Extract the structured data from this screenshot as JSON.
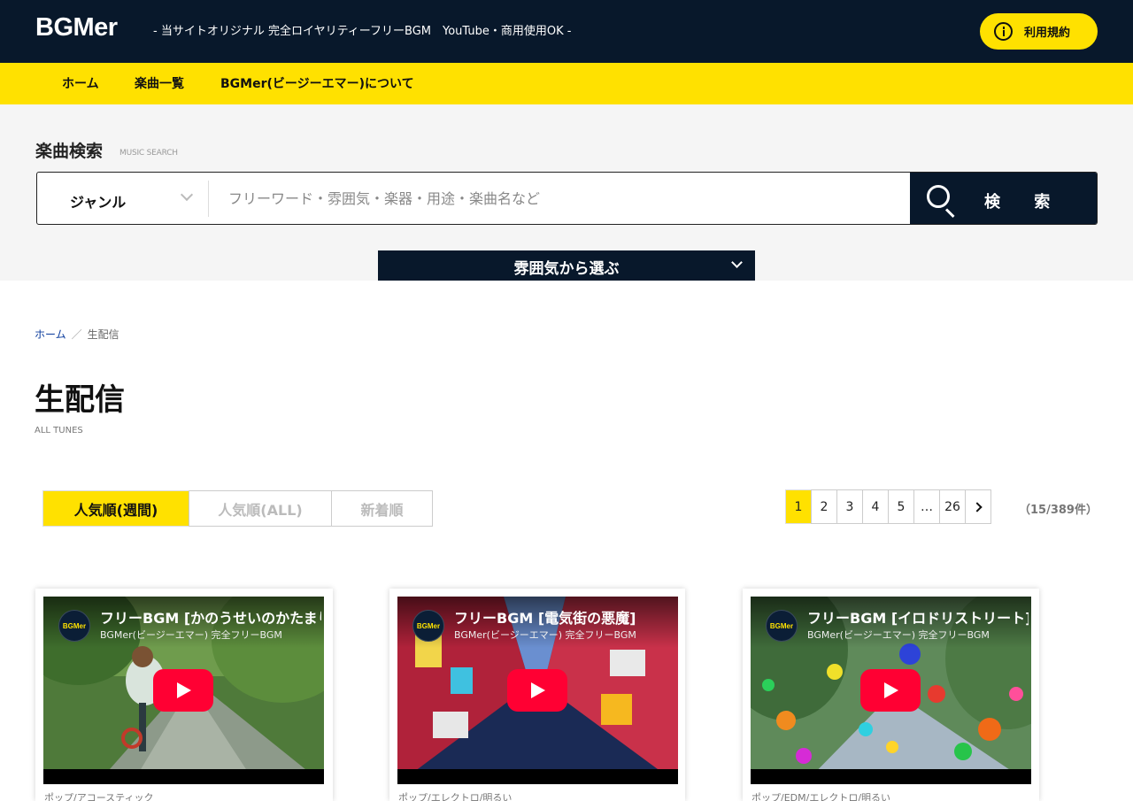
{
  "header": {
    "logo": "BGMer",
    "tagline": "- 当サイトオリジナル 完全ロイヤリティーフリーBGM　YouTube・商用使用OK -",
    "terms_label": "利用規約"
  },
  "nav": {
    "items": [
      "ホーム",
      "楽曲一覧",
      "BGMer(ビージーエマー)について"
    ]
  },
  "search": {
    "title": "楽曲検索",
    "subtitle": "MUSIC SEARCH",
    "genre_label": "ジャンル",
    "placeholder": "フリーワード・雰囲気・楽器・用途・楽曲名など",
    "button_label": "検 索",
    "mood_label": "雰囲気から選ぶ"
  },
  "breadcrumb": {
    "home": "ホーム",
    "separator": "／",
    "current": "生配信"
  },
  "page": {
    "title": "生配信",
    "subtitle": "ALL TUNES"
  },
  "sort_tabs": [
    {
      "label": "人気順(週間)",
      "active": true
    },
    {
      "label": "人気順(ALL)",
      "active": false
    },
    {
      "label": "新着順",
      "active": false
    }
  ],
  "pagination": {
    "pages": [
      "1",
      "2",
      "3",
      "4",
      "5",
      "…",
      "26"
    ],
    "current": "1",
    "count_text": "（15/389件）"
  },
  "cards": [
    {
      "channel_avatar": "BGMer",
      "title": "フリーBGM [かのうせいのかたまり]",
      "channel": "BGMer(ビージーエマー) 完全フリーBGM",
      "meta": "ポップ/アコースティック"
    },
    {
      "channel_avatar": "BGMer",
      "title": "フリーBGM [電気街の悪魔]",
      "channel": "BGMer(ビージーエマー) 完全フリーBGM",
      "meta": "ポップ/エレクトロ/明るい"
    },
    {
      "channel_avatar": "BGMer",
      "title": "フリーBGM [イロドリストリート]",
      "channel": "BGMer(ビージーエマー) 完全フリーBGM",
      "meta": "ポップ/EDM/エレクトロ/明るい"
    }
  ],
  "colors": {
    "header_bg": "#08182b",
    "accent": "#ffe100",
    "play_red": "#ff0033"
  }
}
